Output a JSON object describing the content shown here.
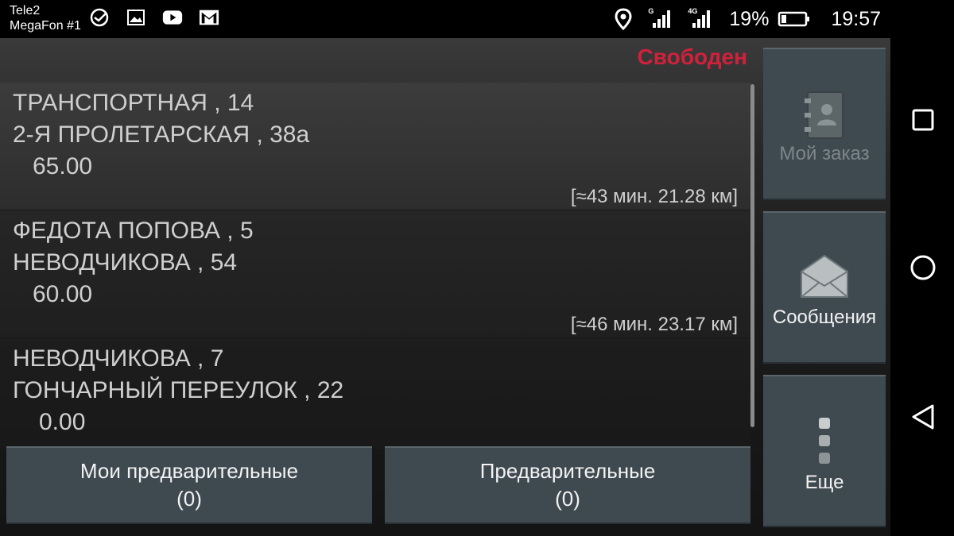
{
  "statusbar": {
    "carrier1": "Tele2",
    "carrier2": "MegaFon #1",
    "sig1_tag": "G",
    "sig2_tag": "4G",
    "battery_pct": "19%",
    "time": "19:57"
  },
  "header": {
    "status": "Свободен",
    "status_color": "#d0213b"
  },
  "orders": [
    {
      "from": "ТРАНСПОРТНАЯ , 14",
      "to": "2-Я ПРОЛЕТАРСКАЯ , 38а",
      "price": "65.00",
      "eta": "[≈43 мин. 21.28 км]"
    },
    {
      "from": "ФЕДОТА ПОПОВА , 5",
      "to": "НЕВОДЧИКОВА , 54",
      "price": "60.00",
      "eta": "[≈46 мин. 23.17 км]"
    },
    {
      "from": "НЕВОДЧИКОВА , 7",
      "to": "ГОНЧАРНЫЙ ПЕРЕУЛОК , 22",
      "price": "0.00",
      "eta": ""
    }
  ],
  "bottom": {
    "my_pre_label": "Мои предварительные",
    "my_pre_count": "(0)",
    "pre_label": "Предварительные",
    "pre_count": "(0)"
  },
  "side": {
    "my_order": "Мой заказ",
    "messages": "Сообщения",
    "more": "Еще"
  },
  "icons": {
    "contacts": "contacts-book-icon",
    "messages": "envelope-icon",
    "more": "more-dots-icon",
    "nav": [
      "recent-apps-icon",
      "home-icon",
      "back-icon"
    ]
  }
}
